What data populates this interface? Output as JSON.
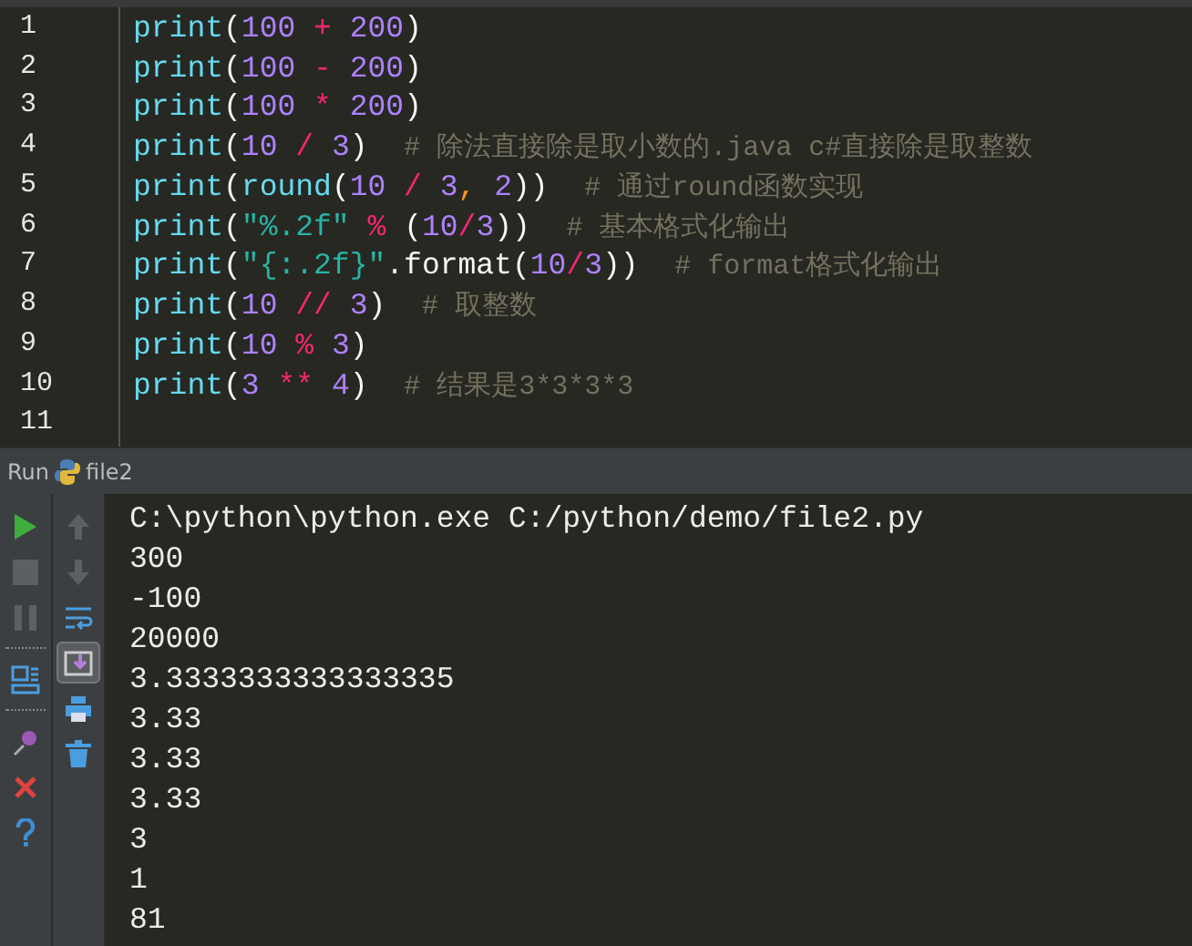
{
  "editor": {
    "lines": [
      {
        "number": "1",
        "tokens": [
          {
            "kind": "builtin",
            "text": "print"
          },
          {
            "kind": "plain",
            "text": "("
          },
          {
            "kind": "number",
            "text": "100"
          },
          {
            "kind": "operator",
            "text": " + "
          },
          {
            "kind": "number",
            "text": "200"
          },
          {
            "kind": "plain",
            "text": ")"
          }
        ]
      },
      {
        "number": "2",
        "tokens": [
          {
            "kind": "builtin",
            "text": "print"
          },
          {
            "kind": "plain",
            "text": "("
          },
          {
            "kind": "number",
            "text": "100"
          },
          {
            "kind": "operator",
            "text": " - "
          },
          {
            "kind": "number",
            "text": "200"
          },
          {
            "kind": "plain",
            "text": ")"
          }
        ]
      },
      {
        "number": "3",
        "tokens": [
          {
            "kind": "builtin",
            "text": "print"
          },
          {
            "kind": "plain",
            "text": "("
          },
          {
            "kind": "number",
            "text": "100"
          },
          {
            "kind": "operator",
            "text": " * "
          },
          {
            "kind": "number",
            "text": "200"
          },
          {
            "kind": "plain",
            "text": ")"
          }
        ]
      },
      {
        "number": "4",
        "tokens": [
          {
            "kind": "builtin",
            "text": "print"
          },
          {
            "kind": "plain",
            "text": "("
          },
          {
            "kind": "number",
            "text": "10"
          },
          {
            "kind": "operator",
            "text": " / "
          },
          {
            "kind": "number",
            "text": "3"
          },
          {
            "kind": "plain",
            "text": ")  "
          },
          {
            "kind": "comment",
            "text": "# 除法直接除是取小数的.java c#直接除是取整数"
          }
        ]
      },
      {
        "number": "5",
        "tokens": [
          {
            "kind": "builtin",
            "text": "print"
          },
          {
            "kind": "plain",
            "text": "("
          },
          {
            "kind": "builtin",
            "text": "round"
          },
          {
            "kind": "plain",
            "text": "("
          },
          {
            "kind": "number",
            "text": "10"
          },
          {
            "kind": "operator",
            "text": " / "
          },
          {
            "kind": "number",
            "text": "3"
          },
          {
            "kind": "comma",
            "text": ", "
          },
          {
            "kind": "number",
            "text": "2"
          },
          {
            "kind": "plain",
            "text": "))  "
          },
          {
            "kind": "comment",
            "text": "# 通过round函数实现"
          }
        ]
      },
      {
        "number": "6",
        "tokens": [
          {
            "kind": "builtin",
            "text": "print"
          },
          {
            "kind": "plain",
            "text": "("
          },
          {
            "kind": "string",
            "text": "\"%.2f\""
          },
          {
            "kind": "operator",
            "text": " % "
          },
          {
            "kind": "plain",
            "text": "("
          },
          {
            "kind": "number",
            "text": "10"
          },
          {
            "kind": "operator",
            "text": "/"
          },
          {
            "kind": "number",
            "text": "3"
          },
          {
            "kind": "plain",
            "text": "))  "
          },
          {
            "kind": "comment",
            "text": "# 基本格式化输出"
          }
        ]
      },
      {
        "number": "7",
        "tokens": [
          {
            "kind": "builtin",
            "text": "print"
          },
          {
            "kind": "plain",
            "text": "("
          },
          {
            "kind": "string",
            "text": "\"{:.2f}\""
          },
          {
            "kind": "plain",
            "text": ".format("
          },
          {
            "kind": "number",
            "text": "10"
          },
          {
            "kind": "operator",
            "text": "/"
          },
          {
            "kind": "number",
            "text": "3"
          },
          {
            "kind": "plain",
            "text": "))  "
          },
          {
            "kind": "comment",
            "text": "# format格式化输出"
          }
        ]
      },
      {
        "number": "8",
        "tokens": [
          {
            "kind": "builtin",
            "text": "print"
          },
          {
            "kind": "plain",
            "text": "("
          },
          {
            "kind": "number",
            "text": "10"
          },
          {
            "kind": "operator",
            "text": " // "
          },
          {
            "kind": "number",
            "text": "3"
          },
          {
            "kind": "plain",
            "text": ")  "
          },
          {
            "kind": "comment",
            "text": "# 取整数"
          }
        ]
      },
      {
        "number": "9",
        "tokens": [
          {
            "kind": "builtin",
            "text": "print"
          },
          {
            "kind": "plain",
            "text": "("
          },
          {
            "kind": "number",
            "text": "10"
          },
          {
            "kind": "operator",
            "text": " % "
          },
          {
            "kind": "number",
            "text": "3"
          },
          {
            "kind": "plain",
            "text": ")"
          }
        ]
      },
      {
        "number": "10",
        "tokens": [
          {
            "kind": "builtin",
            "text": "print"
          },
          {
            "kind": "plain",
            "text": "("
          },
          {
            "kind": "number",
            "text": "3"
          },
          {
            "kind": "operator",
            "text": " ** "
          },
          {
            "kind": "number",
            "text": "4"
          },
          {
            "kind": "plain",
            "text": ")  "
          },
          {
            "kind": "comment",
            "text": "# 结果是3*3*3*3"
          }
        ]
      },
      {
        "number": "11"
      }
    ]
  },
  "run_panel": {
    "label": "Run",
    "tab": "file2",
    "left_tools": [
      [
        {
          "kind": "run",
          "disabled": false
        },
        {
          "kind": "stop",
          "disabled": true
        },
        {
          "kind": "pause",
          "disabled": true
        }
      ],
      [
        {
          "kind": "layout",
          "disabled": false
        }
      ],
      [
        {
          "kind": "pin",
          "disabled": false
        },
        {
          "kind": "close",
          "disabled": false
        },
        {
          "kind": "help",
          "disabled": false
        }
      ]
    ],
    "right_tools": [
      {
        "kind": "up",
        "disabled": true,
        "selected": false
      },
      {
        "kind": "down",
        "disabled": true,
        "selected": false
      },
      {
        "kind": "wrap",
        "disabled": false,
        "selected": false
      },
      {
        "kind": "scroll-end",
        "disabled": false,
        "selected": true
      },
      {
        "kind": "print",
        "disabled": false,
        "selected": false
      },
      {
        "kind": "trash",
        "disabled": false,
        "selected": false
      }
    ],
    "output": [
      "C:\\python\\python.exe C:/python/demo/file2.py",
      "300",
      "-100",
      "20000",
      "3.3333333333333335",
      "3.33",
      "3.33",
      "3.33",
      "3",
      "1",
      "81"
    ]
  }
}
